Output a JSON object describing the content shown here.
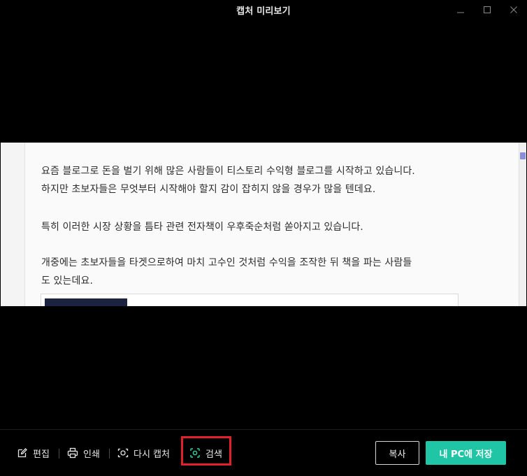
{
  "window": {
    "title": "캡처 미리보기"
  },
  "capture": {
    "paragraphs": [
      [
        "요즘 블로그로 돈을 벌기 위해 많은 사람들이 티스토리 수익형 블로그를 시작하고 있습니다.",
        "하지만 초보자들은 무엇부터 시작해야 할지 감이 잡히지 않을 경우가 많을 텐데요."
      ],
      [
        "특히 이러한 시장 상황을 틈타 관련 전자책이 우후죽순처럼 쏟아지고 있습니다."
      ],
      [
        "개중에는 초보자들을 타겟으로하여 마치 고수인 것처럼 수익을 조작한 뒤 책을 파는 사람들",
        "도 있는데요."
      ]
    ]
  },
  "toolbar": {
    "edit_label": "편집",
    "print_label": "인쇄",
    "recapture_label": "다시 캡처",
    "search_label": "검색",
    "copy_label": "복사",
    "save_label": "내 PC에 저장"
  },
  "icons": {
    "edit": "pencil-icon",
    "print": "printer-icon",
    "recapture": "camera-icon",
    "search": "lens-search-icon"
  },
  "colors": {
    "accent": "#1fc5a4",
    "highlight": "#e0202a",
    "search_icon": "#2fd3a6"
  }
}
